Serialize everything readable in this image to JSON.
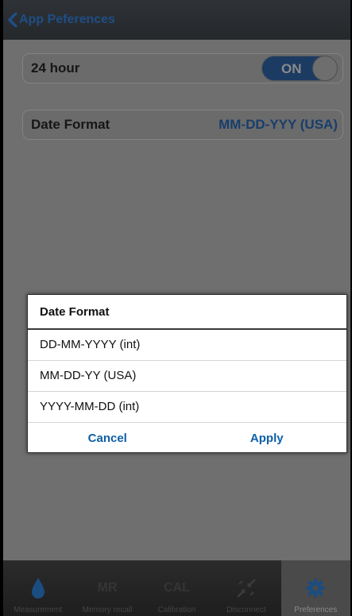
{
  "colors": {
    "accent": "#1f4e86",
    "dim_overlay": "#6f6f6f",
    "dialog_button": "#0e5fa6",
    "active_tab": "#1b4d80"
  },
  "navbar": {
    "back_label": "App Peferences",
    "back_icon": "chevron-left-icon"
  },
  "settings": {
    "hour24": {
      "label": "24 hour",
      "toggle_text": "ON",
      "on": true
    },
    "date_format": {
      "label": "Date Format",
      "value": "MM-DD-YYY (USA)"
    }
  },
  "dialog": {
    "title": "Date Format",
    "options": [
      "DD-MM-YYYY (int)",
      "MM-DD-YY (USA)",
      "YYYY-MM-DD (int)"
    ],
    "cancel_label": "Cancel",
    "apply_label": "Apply"
  },
  "tabbar": {
    "tabs": [
      {
        "label": "Measurement",
        "icon": "drop-icon"
      },
      {
        "label": "Memory recall",
        "icon_text": "MR"
      },
      {
        "label": "Calibration",
        "icon_text": "CAL"
      },
      {
        "label": "Disconnect",
        "icon": "disconnect-arrows-icon"
      },
      {
        "label": "Preferences",
        "icon": "gear-icon",
        "active": true
      }
    ]
  }
}
